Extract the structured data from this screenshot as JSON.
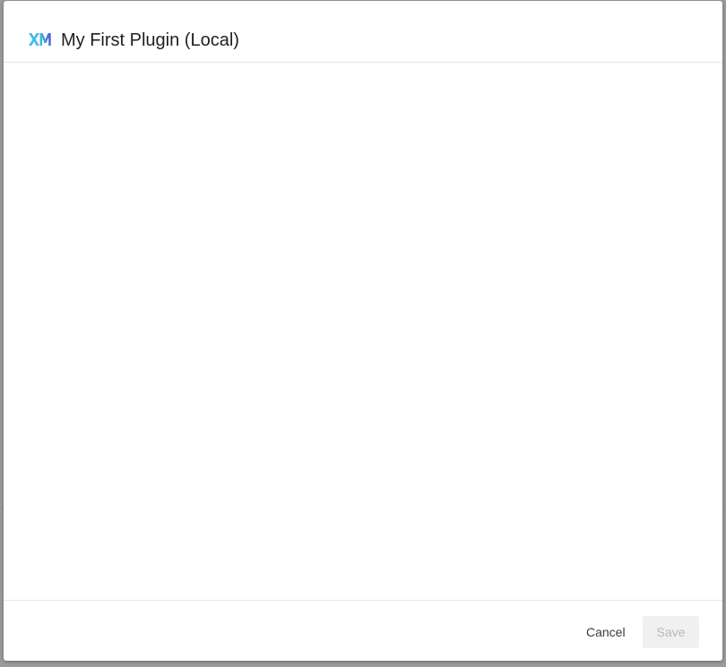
{
  "dialog": {
    "title": "My First Plugin (Local)",
    "logo_icon": "xm-logo-icon",
    "logo_colors": [
      "#3fb8e8",
      "#4a63d8"
    ]
  },
  "footer": {
    "cancel_label": "Cancel",
    "save_label": "Save"
  }
}
